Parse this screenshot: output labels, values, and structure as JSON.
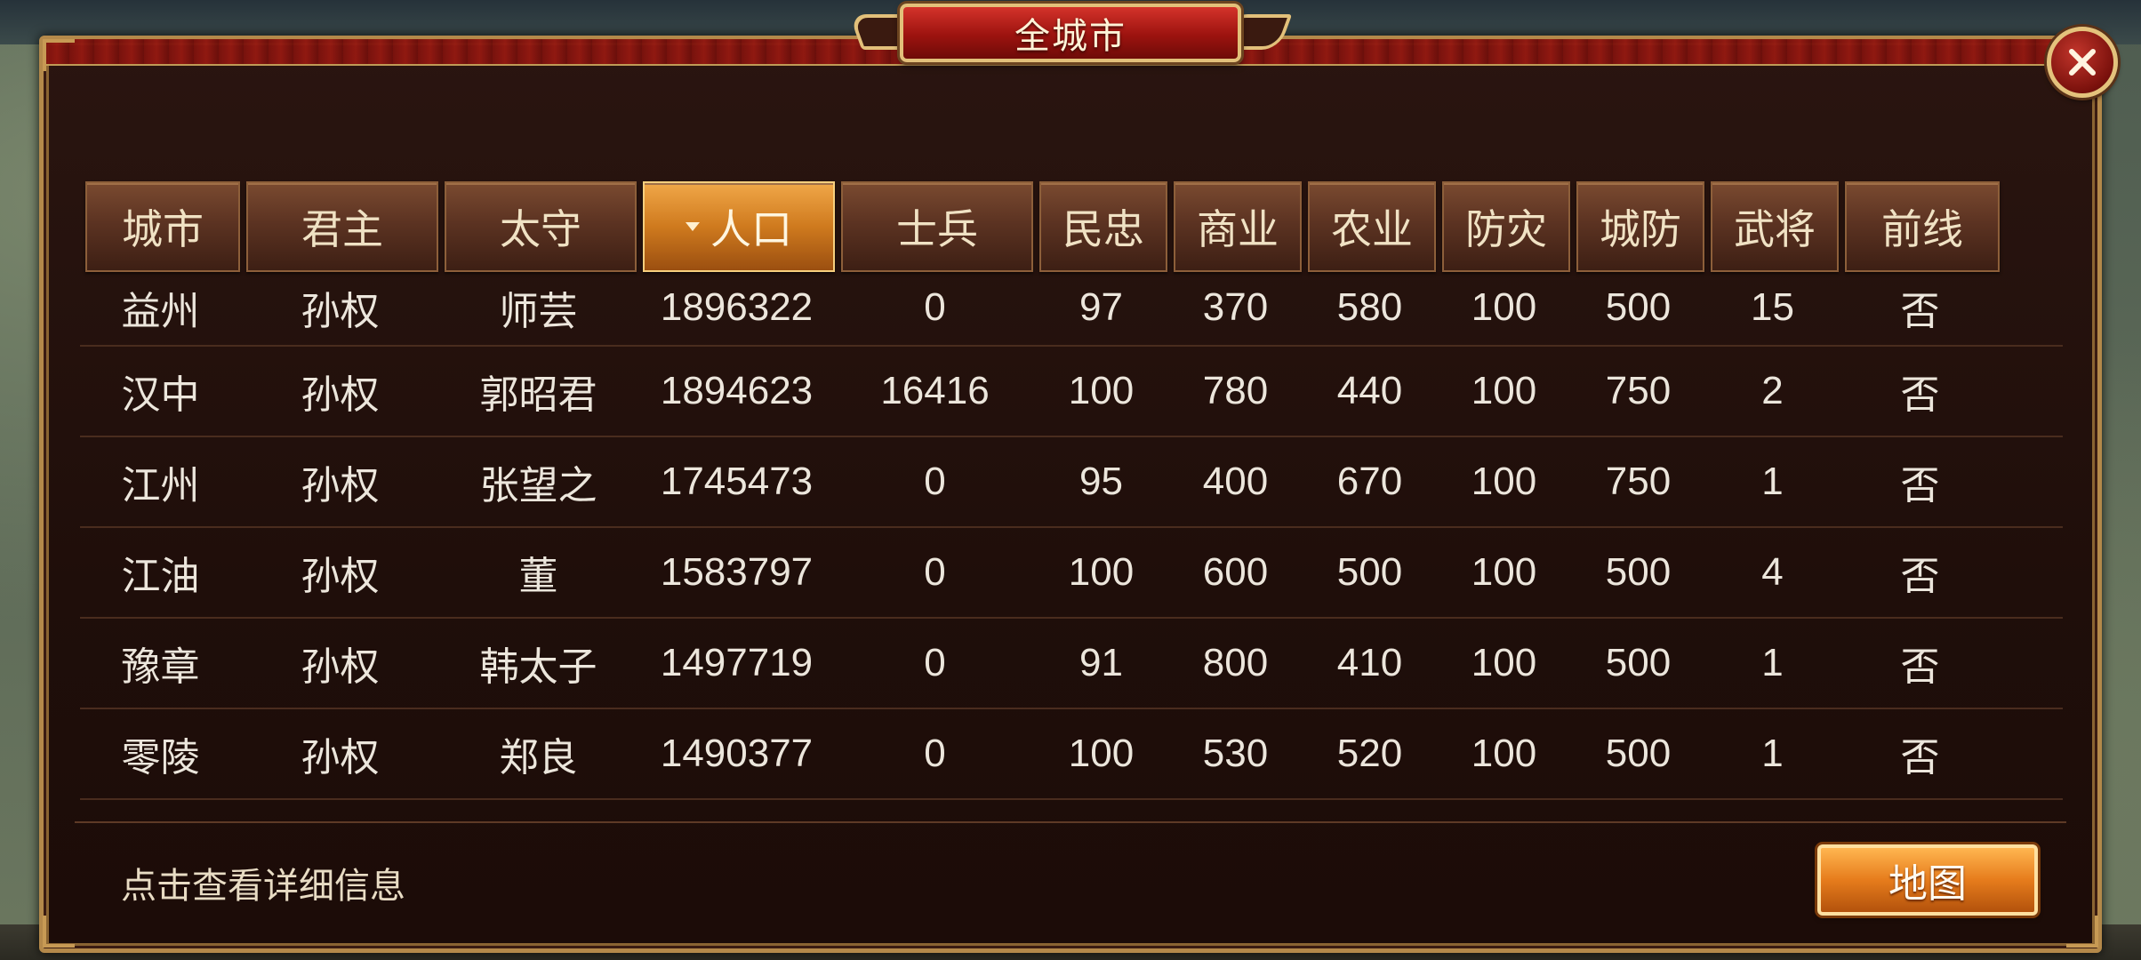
{
  "window": {
    "title": "全城市"
  },
  "table": {
    "columns": [
      "城市",
      "君主",
      "太守",
      "人口",
      "士兵",
      "民忠",
      "商业",
      "农业",
      "防灾",
      "城防",
      "武将",
      "前线"
    ],
    "sorted_column": "人口",
    "rows": [
      [
        "益州",
        "孙权",
        "师芸",
        "1896322",
        "0",
        "97",
        "370",
        "580",
        "100",
        "500",
        "15",
        "否"
      ],
      [
        "汉中",
        "孙权",
        "郭昭君",
        "1894623",
        "16416",
        "100",
        "780",
        "440",
        "100",
        "750",
        "2",
        "否"
      ],
      [
        "江州",
        "孙权",
        "张望之",
        "1745473",
        "0",
        "95",
        "400",
        "670",
        "100",
        "750",
        "1",
        "否"
      ],
      [
        "江油",
        "孙权",
        "董",
        "1583797",
        "0",
        "100",
        "600",
        "500",
        "100",
        "500",
        "4",
        "否"
      ],
      [
        "豫章",
        "孙权",
        "韩太子",
        "1497719",
        "0",
        "91",
        "800",
        "410",
        "100",
        "500",
        "1",
        "否"
      ],
      [
        "零陵",
        "孙权",
        "郑良",
        "1490377",
        "0",
        "100",
        "530",
        "520",
        "100",
        "500",
        "1",
        "否"
      ]
    ]
  },
  "footer": {
    "hint": "点击查看详细信息",
    "map_button": "地图"
  },
  "icons": {
    "close": "close-icon",
    "sort": "sort-desc-icon"
  },
  "colors": {
    "accent": "#e67c1c",
    "header_active": "#cf7a1e",
    "frame": "#b4894a",
    "title_red": "#9c130f"
  }
}
